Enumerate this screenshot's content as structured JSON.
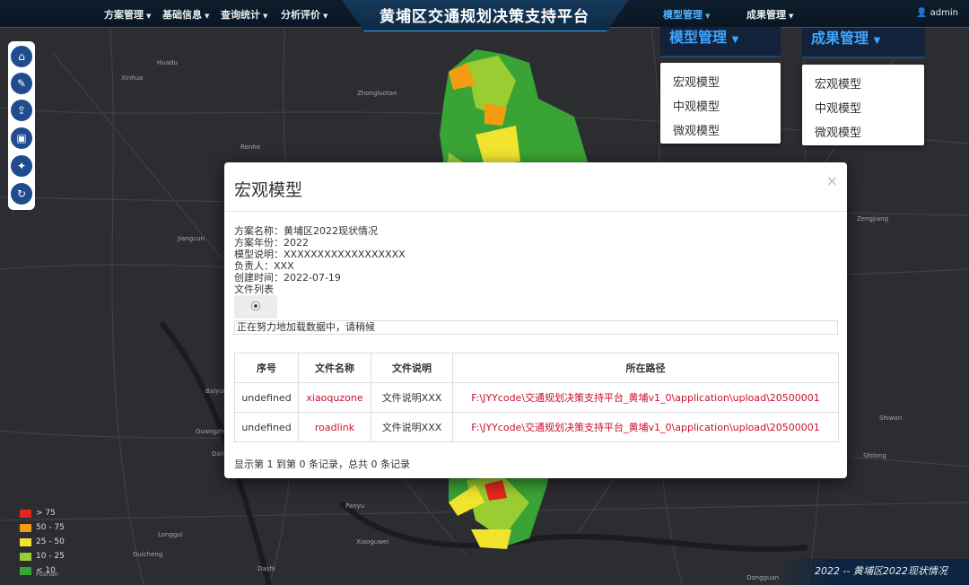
{
  "app": {
    "title": "黄埔区交通规划决策支持平台",
    "user": "admin",
    "user_icon": "user-icon"
  },
  "nav": [
    {
      "label": "方案管理"
    },
    {
      "label": "基础信息"
    },
    {
      "label": "查询统计"
    },
    {
      "label": "分析评价"
    },
    {
      "label": "模型管理"
    },
    {
      "label": "成果管理"
    }
  ],
  "toolbar": {
    "icons": [
      "home-icon",
      "edit-icon",
      "upload-icon",
      "image-icon",
      "magic-wand-icon",
      "refresh-icon"
    ]
  },
  "dropdowns": {
    "model": {
      "header": "模型管理",
      "items": [
        "宏观模型",
        "中观模型",
        "微观模型"
      ]
    },
    "result": {
      "header": "成果管理",
      "items": [
        "宏观模型",
        "中观模型",
        "微观模型"
      ]
    }
  },
  "modal": {
    "title": "宏观模型",
    "close": "×",
    "info": [
      "方案名称：黄埔区2022现状情况",
      "方案年份：2022",
      "模型说明：XXXXXXXXXXXXXXXXXX",
      "负责人：XXX",
      "创建时间：2022-07-19",
      "文件列表"
    ],
    "spinner_text": "⦿",
    "loading_text": "正在努力地加载数据中，请稍候",
    "table": {
      "headers": [
        "序号",
        "文件名称",
        "文件说明",
        "所在路径"
      ],
      "rows": [
        [
          "undefined",
          "xiaoquzone",
          "文件说明XXX",
          "F:\\JYYcode\\交通规划决策支持平台_黄埔v1_0\\application\\upload\\20500001"
        ],
        [
          "undefined",
          "roadlink",
          "文件说明XXX",
          "F:\\JYYcode\\交通规划决策支持平台_黄埔v1_0\\application\\upload\\20500001"
        ]
      ]
    },
    "footer": "显示第 1 到第 0 条记录，总共 0 条记录"
  },
  "legend": [
    {
      "label": "> 75",
      "color": "#e4261f"
    },
    {
      "label": "50 - 75",
      "color": "#f39c12"
    },
    {
      "label": "25 - 50",
      "color": "#f1e42e"
    },
    {
      "label": "10 - 25",
      "color": "#9acd32"
    },
    {
      "label": "< 10",
      "color": "#3aa335"
    }
  ],
  "bottom_label": "2022 -- 黄埔区2022现状情况",
  "map_labels": [
    "Huadu",
    "Xinhua",
    "Zhongluotan",
    "Baiyun",
    "Guangzhou",
    "Panyu",
    "Shiwan",
    "Shilong",
    "Foshan",
    "Dongguan",
    "Zengjiang",
    "Dali",
    "Jiangcun",
    "Renhe",
    "Longgui",
    "Xiaoguwei",
    "Dashi",
    "Guicheng"
  ]
}
